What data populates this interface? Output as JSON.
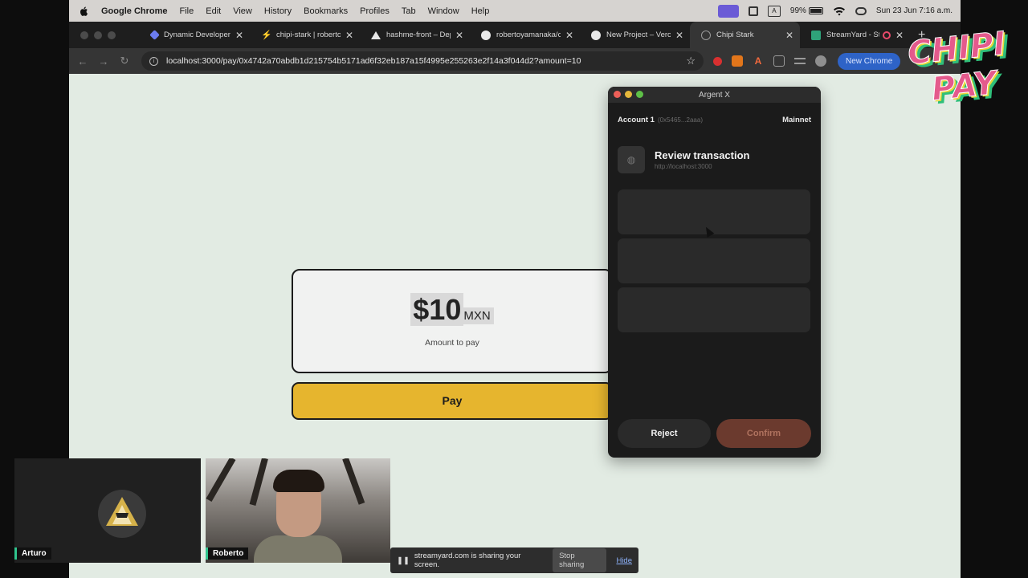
{
  "menubar": {
    "app": "Google Chrome",
    "items": [
      "File",
      "Edit",
      "View",
      "History",
      "Bookmarks",
      "Profiles",
      "Tab",
      "Window",
      "Help"
    ],
    "battery": "99%",
    "datetime": "Sun 23 Jun  7:16 a.m."
  },
  "tabs": [
    {
      "title": "Dynamic Developer",
      "favicon_color": "#6b7cf0"
    },
    {
      "title": "chipi-stark | roberto",
      "favicon_color": "#3fbf6a"
    },
    {
      "title": "hashme-front – Dep",
      "favicon_color": "#e8e8e8"
    },
    {
      "title": "robertoyamanaka/c",
      "favicon_color": "#e8e8e8"
    },
    {
      "title": "New Project – Verce",
      "favicon_color": "#e8e8e8"
    },
    {
      "title": "Chipi Stark",
      "favicon_color": "#9a9a9a"
    },
    {
      "title": "StreamYard - St",
      "favicon_color": "#2fa37a"
    }
  ],
  "addressbar": {
    "url": "localhost:3000/pay/0x4742a70abdb1d215754b5171ad6f32eb187a15f4995e255263e2f14a3f044d2?amount=10",
    "profile_button": "New Chrome"
  },
  "page": {
    "amount_value": "$10",
    "amount_currency": "MXN",
    "amount_label": "Amount to pay",
    "pay_label": "Pay"
  },
  "argent": {
    "window_title": "Argent X",
    "account_name": "Account 1",
    "account_address": "(0x5465...2aaa)",
    "network": "Mainnet",
    "heading": "Review transaction",
    "origin": "http://localhost:3000",
    "reject_label": "Reject",
    "confirm_label": "Confirm"
  },
  "participants": {
    "arturo": "Arturo",
    "roberto": "Roberto"
  },
  "sharing": {
    "message": "streamyard.com is sharing your screen.",
    "stop_label": "Stop sharing",
    "hide_label": "Hide"
  },
  "colors": {
    "page_bg": "#e2ebe3",
    "pay_button": "#e6b52e",
    "confirm_button": "#6b3a2e",
    "argent_bg": "#1b1b1b"
  }
}
